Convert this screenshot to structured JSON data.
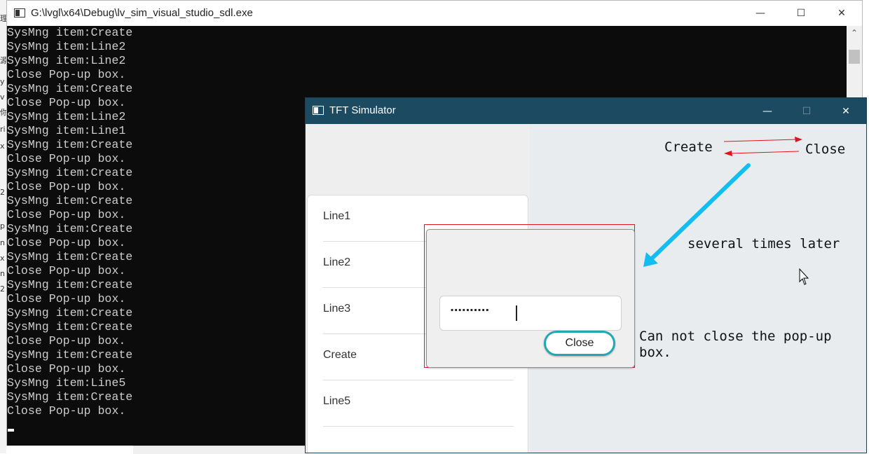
{
  "console": {
    "title": "G:\\lvgl\\x64\\Debug\\lv_sim_visual_studio_sdl.exe",
    "lines": [
      "SysMng item:Create",
      "SysMng item:Line2",
      "SysMng item:Line2",
      "Close Pop-up box.",
      "SysMng item:Create",
      "Close Pop-up box.",
      "SysMng item:Line2",
      "SysMng item:Line1",
      "SysMng item:Create",
      "Close Pop-up box.",
      "SysMng item:Create",
      "Close Pop-up box.",
      "SysMng item:Create",
      "Close Pop-up box.",
      "SysMng item:Create",
      "Close Pop-up box.",
      "SysMng item:Create",
      "Close Pop-up box.",
      "SysMng item:Create",
      "Close Pop-up box.",
      "SysMng item:Create",
      "SysMng item:Create",
      "Close Pop-up box.",
      "SysMng item:Create",
      "Close Pop-up box.",
      "SysMng item:Line5",
      "SysMng item:Create",
      "Close Pop-up box."
    ],
    "minimize_glyph": "—",
    "maximize_glyph": "☐",
    "close_glyph": "✕",
    "scroll_up_glyph": "⌃"
  },
  "tft": {
    "title": "TFT Simulator",
    "minimize_glyph": "—",
    "maximize_glyph": "☐",
    "close_glyph": "✕",
    "list_items": [
      "Line1",
      "Line2",
      "Line3",
      "Create",
      "Line5"
    ],
    "popup": {
      "password_mask": "··········",
      "close_label": "Close"
    }
  },
  "annotations": {
    "create": "Create",
    "close": "Close",
    "several_times": "several times later",
    "cannot_close": "Can not close the pop-up box."
  },
  "ide_strip_glyphs": [
    "理",
    "源",
    "y",
    "v",
    "你",
    "ri",
    "x",
    "2",
    "p",
    "n",
    "x",
    "n",
    "2"
  ],
  "colors": {
    "console_bg": "#0c0c0c",
    "console_text": "#cccccc",
    "tft_titlebar": "#1c4a61",
    "button_border": "#1fa9b4",
    "annotation_red": "#e0141e",
    "annotation_arrow": "#12bdf0"
  }
}
